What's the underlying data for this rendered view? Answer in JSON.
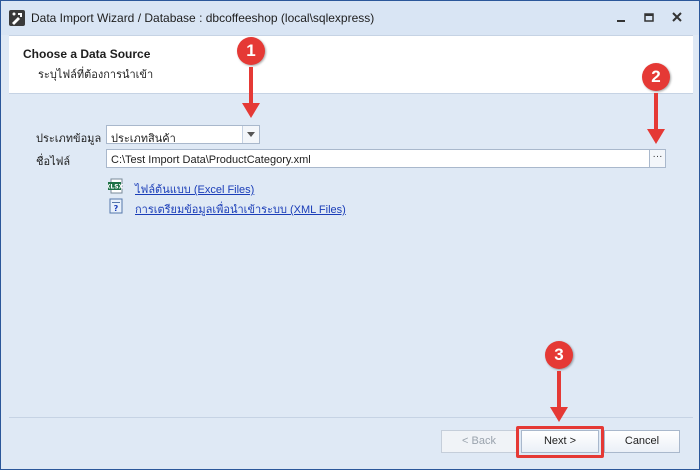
{
  "window": {
    "title": "Data Import Wizard / Database : dbcoffeeshop (local\\sqlexpress)",
    "app_icon": "wizard-tool-icon",
    "controls": [
      "minimize-icon",
      "maximize-icon",
      "close-icon"
    ]
  },
  "header": {
    "title": "Choose a Data Source",
    "subtitle": "ระบุไฟล์ที่ต้องการนำเข้า"
  },
  "form": {
    "data_type_label": "ประเภทข้อมูล",
    "data_type_value": "ประเภทสินค้า",
    "file_label": "ชื่อไฟล์",
    "file_value": "C:\\Test Import Data\\ProductCategory.xml",
    "browse_label": "···"
  },
  "links": [
    {
      "label": "ไฟล์ต้นแบบ (Excel Files)",
      "icon": "excel-file-icon"
    },
    {
      "label": "การเตรียมข้อมูลเพื่อนำเข้าระบบ (XML Files)",
      "icon": "help-document-icon"
    }
  ],
  "footer": {
    "back_label": "< Back",
    "next_label": "Next >",
    "cancel_label": "Cancel"
  },
  "annotations": {
    "step1": "1",
    "step2": "2",
    "step3": "3",
    "color": "#e53935"
  },
  "colors": {
    "frame": "#2b579a",
    "body_bg": "#dfe9f5",
    "link": "#1a3db8"
  }
}
